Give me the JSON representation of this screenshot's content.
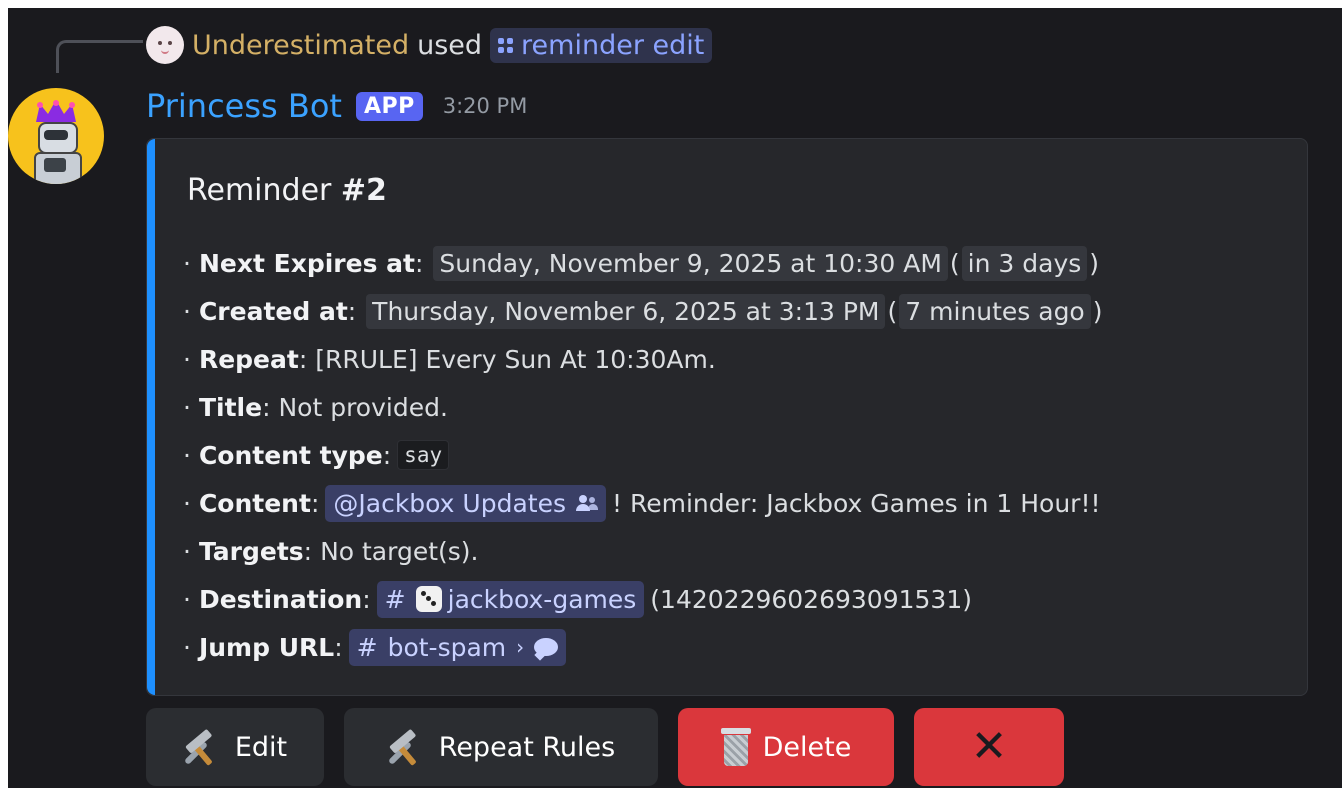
{
  "reply": {
    "user": "Underestimated",
    "used_text": "used",
    "command": "reminder edit"
  },
  "message": {
    "author": "Princess Bot",
    "badge": "APP",
    "time": "3:20 PM"
  },
  "embed": {
    "accent_color": "#1e90ff",
    "title_prefix": "Reminder ",
    "title_number": "#2",
    "fields": {
      "next_expires": {
        "label": "Next Expires at",
        "value": "Sunday, November 9, 2025 at 10:30 AM",
        "relative": "in 3 days"
      },
      "created": {
        "label": "Created at",
        "value": "Thursday, November 6, 2025 at 3:13 PM",
        "relative": "7 minutes ago"
      },
      "repeat": {
        "label": "Repeat",
        "value": "[RRULE] Every Sun At 10:30Am."
      },
      "title": {
        "label": "Title",
        "value": "Not provided."
      },
      "content_type": {
        "label": "Content type",
        "value": "say"
      },
      "content": {
        "label": "Content",
        "mention": "@Jackbox Updates",
        "text": "! Reminder: Jackbox Games in 1 Hour!!"
      },
      "targets": {
        "label": "Targets",
        "value": "No target(s)."
      },
      "destination": {
        "label": "Destination",
        "channel": "jackbox-games",
        "id": "(1420229602693091531)"
      },
      "jump_url": {
        "label": "Jump URL",
        "channel": "bot-spam"
      }
    }
  },
  "buttons": {
    "edit": "Edit",
    "repeat_rules": "Repeat Rules",
    "delete": "Delete",
    "close": "✕"
  },
  "symbols": {
    "bullet": "·",
    "colon": ":",
    "hash": "#",
    "chevron": "›",
    "open_paren": "(",
    "close_paren": ")"
  },
  "colors": {
    "background": "#1a1a1e",
    "username_reply": "#d4b066",
    "bot_name": "#3ba2ff",
    "app_badge": "#5865f2",
    "danger": "#da373c",
    "secondary": "#2b2d31"
  }
}
